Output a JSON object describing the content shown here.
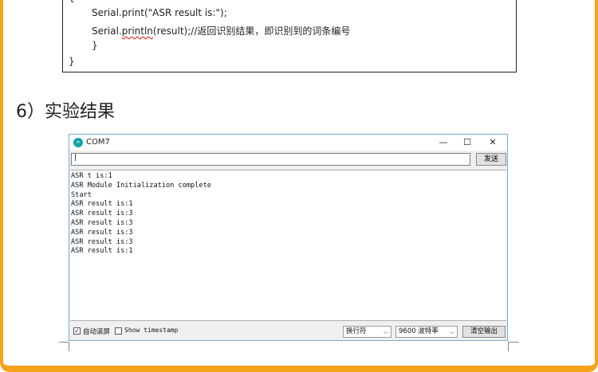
{
  "code": {
    "brace_open": "{",
    "line1": "Serial.print(\"ASR result is:\");",
    "line2_prefix": "Serial.",
    "line2_squiggle": "println",
    "line2_suffix": "(result);//返回识别结果，即识别到的词条编号",
    "inner_close": "}",
    "outer_close": "}"
  },
  "section": {
    "title": "6）实验结果"
  },
  "window": {
    "title": "COM7",
    "icon_text": "∞",
    "min_glyph": "—",
    "max_glyph": "☐",
    "close_glyph": "✕",
    "send_input_value": "|",
    "send_label": "发送",
    "output_lines": [
      "ASR t is:1",
      "ASR Module Initialization complete",
      "Start",
      "ASR result is:1",
      "ASR result is:3",
      "ASR result is:3",
      "ASR result is:3",
      "ASR result is:3",
      "ASR result is:1"
    ],
    "autoscroll_label": "自动滚屏",
    "autoscroll_check": "✓",
    "timestamp_label": "Show timestamp",
    "line_ending": "换行符",
    "baud_rate": "9600 波特率",
    "dropdown_arrow": "⌵",
    "clear_label": "清空输出"
  },
  "colors": {
    "frame": "#f5a31a",
    "window_border": "#7aa7d8",
    "icon": "#14a5a5"
  }
}
